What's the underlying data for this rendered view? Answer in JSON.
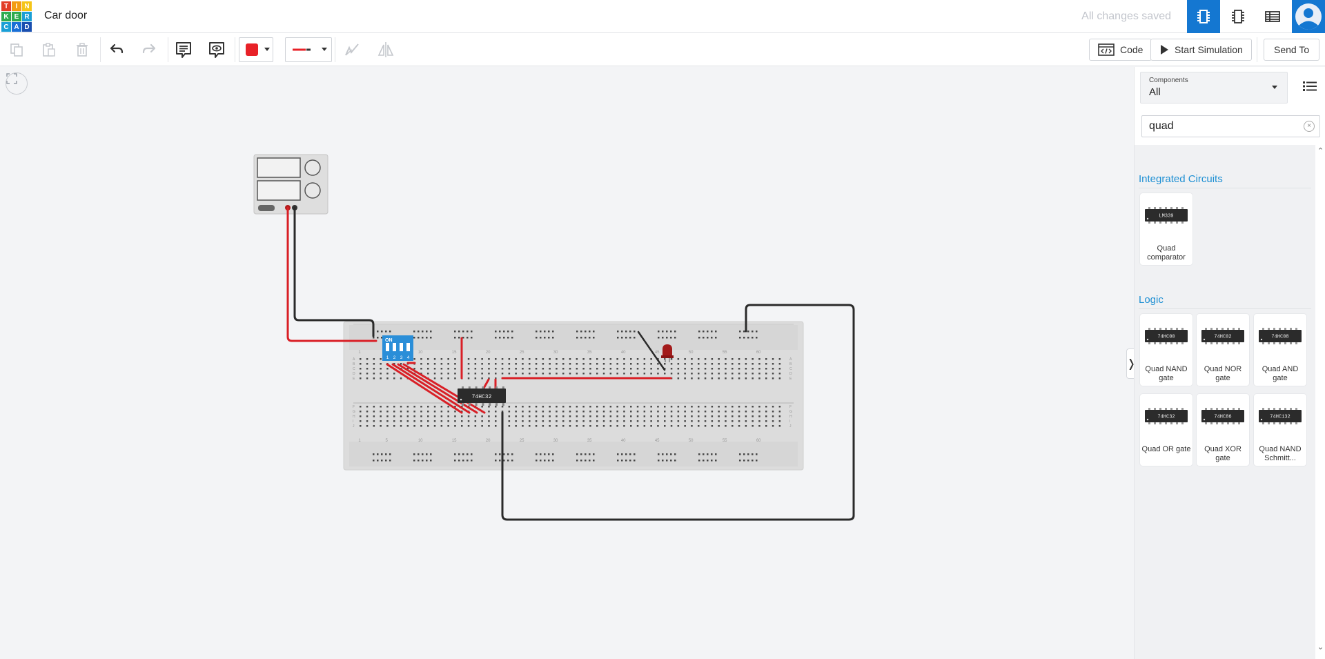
{
  "app": {
    "logo_letters": [
      "T",
      "I",
      "N",
      "K",
      "E",
      "R",
      "C",
      "A",
      "D"
    ],
    "logo_colors": [
      "#e23d28",
      "#f39c12",
      "#f5c518",
      "#2eab4f",
      "#2eab4f",
      "#1a9fd6",
      "#1a9fd6",
      "#1a6fd6",
      "#1a4fb0"
    ],
    "project_title": "Car door",
    "save_status": "All changes saved",
    "views": [
      {
        "name": "circuit-view",
        "icon": "breadboard-chip-icon",
        "active": true
      },
      {
        "name": "schematic-view",
        "icon": "schematic-chip-icon",
        "active": false
      },
      {
        "name": "component-list-view",
        "icon": "table-icon",
        "active": false
      }
    ],
    "accent_color": "#1477d1"
  },
  "toolbar": {
    "icons": [
      "copy-icon",
      "paste-icon",
      "delete-icon",
      "undo-icon",
      "redo-icon",
      "notes-icon",
      "notes-visibility-icon",
      "color-swatch",
      "wire-type",
      "align-icon",
      "flip-icon"
    ],
    "wire_color": "#e82127",
    "code_label": "Code",
    "start_simulation_label": "Start Simulation",
    "send_to_label": "Send To"
  },
  "canvas": {
    "breadboard_top_numbers": [
      "1",
      "5",
      "10",
      "15",
      "20",
      "25",
      "30",
      "35",
      "40",
      "45",
      "50",
      "55",
      "60"
    ],
    "breadboard_row_letters_top": [
      "A",
      "B",
      "C",
      "D",
      "E"
    ],
    "breadboard_row_letters_bottom": [
      "F",
      "G",
      "H",
      "I",
      "J"
    ],
    "ic_label": "74HC32",
    "dip_switch_label": "ON",
    "dip_switch_numbers": [
      "1",
      "2",
      "3",
      "4"
    ]
  },
  "panel": {
    "components_label": "Components",
    "components_value": "All",
    "search_value": "quad",
    "search_clear_symbol": "×",
    "sections": [
      {
        "title": "Integrated Circuits",
        "items": [
          {
            "chip_text": "LM339",
            "label": "Quad comparator"
          }
        ]
      },
      {
        "title": "Logic",
        "items": [
          {
            "chip_text": "74HC00",
            "label": "Quad NAND gate"
          },
          {
            "chip_text": "74HC02",
            "label": "Quad NOR gate"
          },
          {
            "chip_text": "74HC08",
            "label": "Quad AND gate"
          },
          {
            "chip_text": "74HC32",
            "label": "Quad OR gate"
          },
          {
            "chip_text": "74HC86",
            "label": "Quad XOR gate"
          },
          {
            "chip_text": "74HC132",
            "label": "Quad NAND Schmitt..."
          }
        ]
      }
    ],
    "toggle_symbol": "❭"
  }
}
